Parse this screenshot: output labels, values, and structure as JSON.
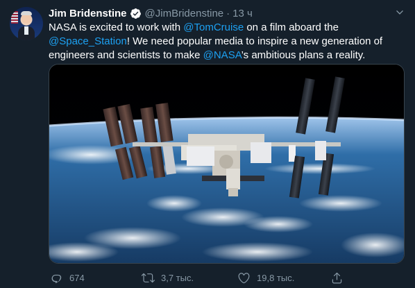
{
  "tweet": {
    "author_name": "Jim Bridenstine",
    "handle": "@JimBridenstine",
    "separator": "·",
    "time": "13 ч",
    "text_parts": [
      "NASA is excited to work with ",
      "@TomCruise",
      " on a film aboard the ",
      "@Space_Station",
      "! We need popular media to inspire a new generation of engineers and scientists to make ",
      "@NASA",
      "’s ambitious plans a reality."
    ],
    "image_subject": "International Space Station above Earth",
    "counts": {
      "replies": "674",
      "retweets": "3,7 тыс.",
      "likes": "19,8 тыс."
    }
  },
  "icons": {
    "verified": "verified-badge-icon",
    "menu": "chevron-down-icon",
    "reply": "reply-icon",
    "retweet": "retweet-icon",
    "like": "heart-icon",
    "share": "share-icon"
  },
  "colors": {
    "background": "#15202b",
    "text": "#ffffff",
    "muted": "#8899a6",
    "link": "#1da1f2",
    "border": "#38444d"
  }
}
